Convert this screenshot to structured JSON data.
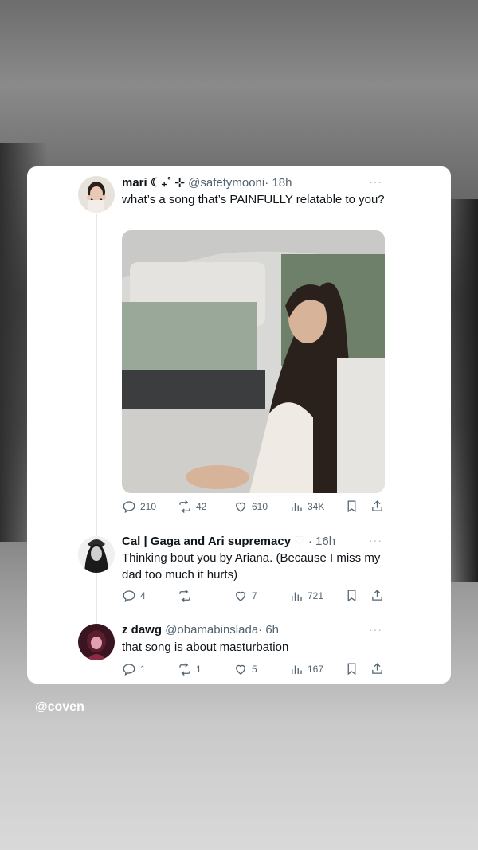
{
  "tweets": [
    {
      "name": "mari ☾₊˚ ⊹",
      "handle": "@safetymooni",
      "time": "· 18h",
      "more": "···",
      "text": "what’s a song that’s PAINFULLY relatable to you?",
      "stats": {
        "replies": "210",
        "retweets": "42",
        "likes": "610",
        "views": "34K"
      }
    },
    {
      "name": "Cal | Gaga and Ari supremacy",
      "handle": "",
      "time": "· 16h",
      "more": "···",
      "text": "Thinking bout you by Ariana. (Because I miss my dad too much it hurts)",
      "stats": {
        "replies": "4",
        "retweets": "",
        "likes": "7",
        "views": "721"
      }
    },
    {
      "name": "z dawg",
      "handle": "@obamabinslada",
      "time": "· 6h",
      "more": "···",
      "text": "that song is about masturbation",
      "stats": {
        "replies": "1",
        "retweets": "1",
        "likes": "5",
        "views": "167"
      }
    }
  ],
  "credit": "@coven",
  "icons": [
    "reply-icon",
    "retweet-icon",
    "like-icon",
    "views-icon",
    "bookmark-icon",
    "share-icon"
  ],
  "colors": {
    "text": "#0f1419",
    "secondary": "#536471",
    "card": "#ffffff"
  }
}
